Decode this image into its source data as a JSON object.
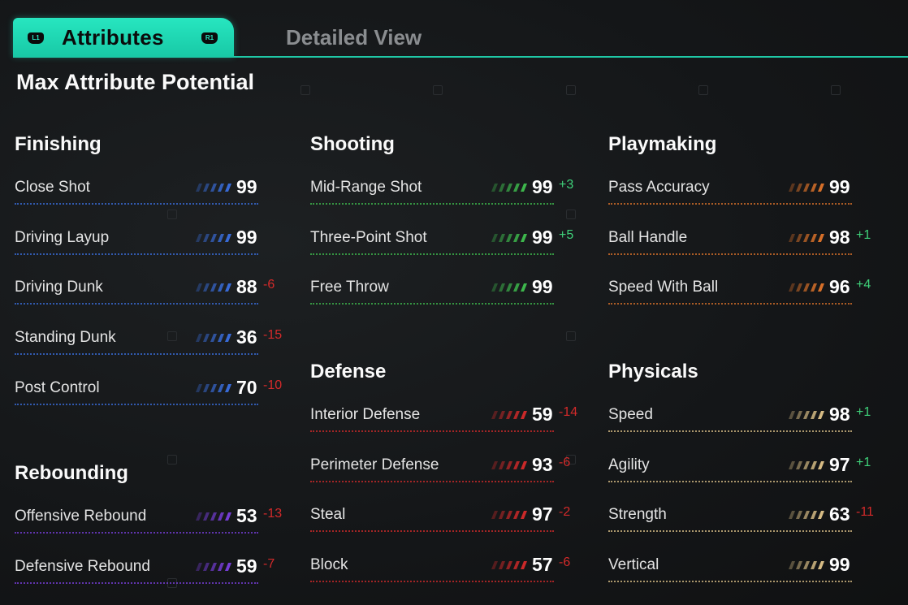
{
  "tabs": {
    "active_label": "Attributes",
    "inactive_label": "Detailed View",
    "left_button": "L1",
    "right_button": "R1"
  },
  "page_title": "Max Attribute Potential",
  "colors": {
    "finishing": "#3a6fe0",
    "rebounding": "#7a3fe0",
    "shooting": "#3fbf4f",
    "defense": "#d42a2a",
    "playmaking": "#e0742a",
    "physicals": "#e0c48a",
    "positive": "#3fd27a",
    "negative": "#d42a2a",
    "tab_accent": "#27e6c0"
  },
  "sections": {
    "finishing": {
      "title": "Finishing",
      "rows": [
        {
          "name": "Close Shot",
          "value": "99",
          "delta": ""
        },
        {
          "name": "Driving Layup",
          "value": "99",
          "delta": ""
        },
        {
          "name": "Driving Dunk",
          "value": "88",
          "delta": "-6"
        },
        {
          "name": "Standing Dunk",
          "value": "36",
          "delta": "-15"
        },
        {
          "name": "Post Control",
          "value": "70",
          "delta": "-10"
        }
      ]
    },
    "rebounding": {
      "title": "Rebounding",
      "rows": [
        {
          "name": "Offensive Rebound",
          "value": "53",
          "delta": "-13"
        },
        {
          "name": "Defensive Rebound",
          "value": "59",
          "delta": "-7"
        }
      ]
    },
    "shooting": {
      "title": "Shooting",
      "rows": [
        {
          "name": "Mid-Range Shot",
          "value": "99",
          "delta": "+3"
        },
        {
          "name": "Three-Point Shot",
          "value": "99",
          "delta": "+5"
        },
        {
          "name": "Free Throw",
          "value": "99",
          "delta": ""
        }
      ]
    },
    "defense": {
      "title": "Defense",
      "rows": [
        {
          "name": "Interior Defense",
          "value": "59",
          "delta": "-14"
        },
        {
          "name": "Perimeter Defense",
          "value": "93",
          "delta": "-6"
        },
        {
          "name": "Steal",
          "value": "97",
          "delta": "-2"
        },
        {
          "name": "Block",
          "value": "57",
          "delta": "-6"
        }
      ]
    },
    "playmaking": {
      "title": "Playmaking",
      "rows": [
        {
          "name": "Pass Accuracy",
          "value": "99",
          "delta": ""
        },
        {
          "name": "Ball Handle",
          "value": "98",
          "delta": "+1"
        },
        {
          "name": "Speed With Ball",
          "value": "96",
          "delta": "+4"
        }
      ]
    },
    "physicals": {
      "title": "Physicals",
      "rows": [
        {
          "name": "Speed",
          "value": "98",
          "delta": "+1"
        },
        {
          "name": "Agility",
          "value": "97",
          "delta": "+1"
        },
        {
          "name": "Strength",
          "value": "63",
          "delta": "-11"
        },
        {
          "name": "Vertical",
          "value": "99",
          "delta": ""
        }
      ]
    }
  }
}
